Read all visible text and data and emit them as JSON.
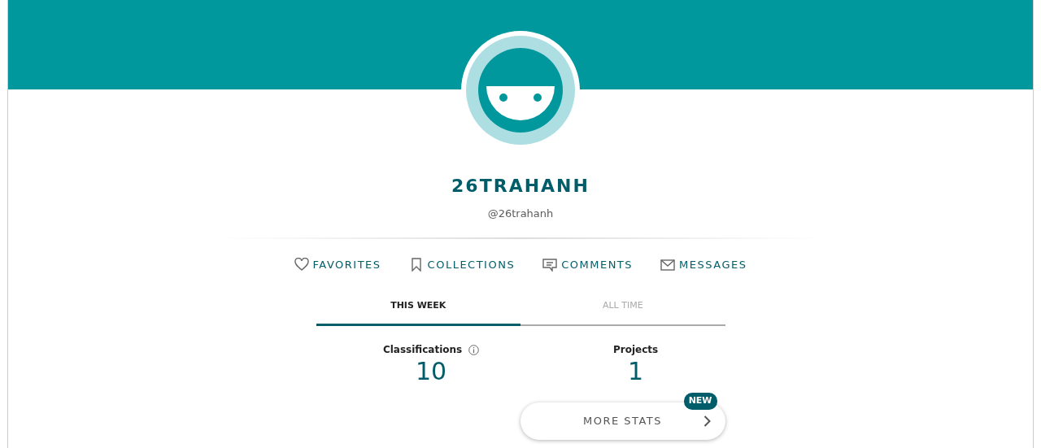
{
  "profile": {
    "display_name": "26TRAHANH",
    "handle": "@26trahanh"
  },
  "links": [
    {
      "label": "FAVORITES",
      "kind": "heart"
    },
    {
      "label": "COLLECTIONS",
      "kind": "bookmark"
    },
    {
      "label": "COMMENTS",
      "kind": "comment"
    },
    {
      "label": "MESSAGES",
      "kind": "mail"
    }
  ],
  "tabs": [
    {
      "label": "THIS WEEK",
      "selected": true
    },
    {
      "label": "ALL TIME",
      "selected": false
    }
  ],
  "stats": [
    {
      "label": "Classifications",
      "value": "10",
      "info": true
    },
    {
      "label": "Projects",
      "value": "1",
      "info": false
    }
  ],
  "more_stats": {
    "label": "MORE STATS",
    "badge": "NEW"
  }
}
